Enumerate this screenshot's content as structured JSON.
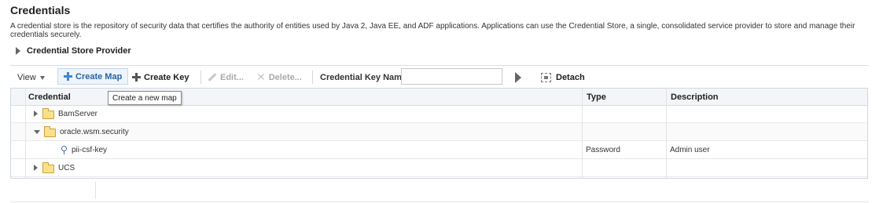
{
  "page": {
    "title": "Credentials",
    "description": "A credential store is the repository of security data that certifies the authority of entities used by Java 2, Java EE, and ADF applications. Applications can use the Credential Store, a single, consolidated service provider to store and manage their credentials securely.",
    "provider_section": "Credential Store Provider"
  },
  "toolbar": {
    "view": "View",
    "create_map": "Create Map",
    "create_key": "Create Key",
    "edit": "Edit...",
    "delete": "Delete...",
    "key_name_label": "Credential Key Name",
    "key_name_value": "",
    "detach": "Detach"
  },
  "tooltip": "Create a new map",
  "table": {
    "columns": [
      "Credential",
      "Type",
      "Description"
    ],
    "rows": [
      {
        "name": "BamServer",
        "kind": "folder",
        "expanded": false,
        "type": "",
        "description": ""
      },
      {
        "name": "oracle.wsm.security",
        "kind": "folder",
        "expanded": true,
        "type": "",
        "description": ""
      },
      {
        "name": "pii-csf-key",
        "kind": "key",
        "type": "Password",
        "description": "Admin user"
      },
      {
        "name": "UCS",
        "kind": "folder",
        "expanded": false,
        "type": "",
        "description": ""
      }
    ]
  },
  "icons": {
    "create_map": "plus-icon",
    "create_key": "plus-icon",
    "edit": "pencil-icon",
    "delete": "delete-x-icon",
    "go": "play-arrow-icon",
    "detach": "detach-icon",
    "folder": "folder-icon",
    "key": "key-icon"
  },
  "colors": {
    "accent": "#2a63a8",
    "header_bg": "#f3f5f8",
    "disabled": "#aaaaaa"
  }
}
